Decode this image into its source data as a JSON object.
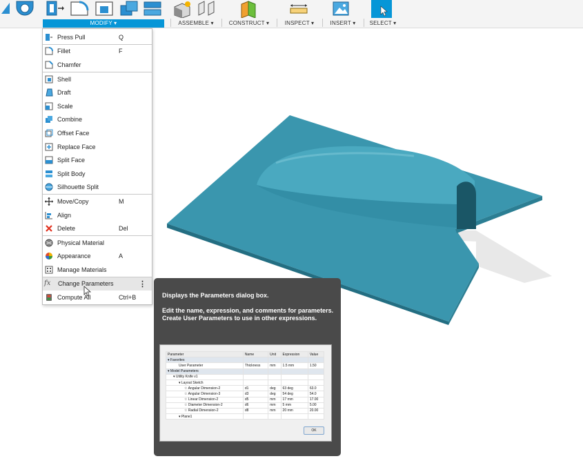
{
  "toolbar": {
    "groups": [
      {
        "label": "MODIFY ▾",
        "active": true
      },
      {
        "label": "ASSEMBLE ▾"
      },
      {
        "label": "CONSTRUCT ▾"
      },
      {
        "label": "INSPECT ▾"
      },
      {
        "label": "INSERT ▾"
      },
      {
        "label": "SELECT ▾"
      }
    ]
  },
  "menu": {
    "items": [
      {
        "label": "Press Pull",
        "shortcut": "Q",
        "icon": "press-pull-icon"
      },
      {
        "label": "Fillet",
        "shortcut": "F",
        "icon": "fillet-icon"
      },
      {
        "label": "Chamfer",
        "shortcut": "",
        "icon": "chamfer-icon"
      },
      {
        "label": "Shell",
        "shortcut": "",
        "icon": "shell-icon"
      },
      {
        "label": "Draft",
        "shortcut": "",
        "icon": "draft-icon"
      },
      {
        "label": "Scale",
        "shortcut": "",
        "icon": "scale-icon"
      },
      {
        "label": "Combine",
        "shortcut": "",
        "icon": "combine-icon"
      },
      {
        "label": "Offset Face",
        "shortcut": "",
        "icon": "offset-face-icon"
      },
      {
        "label": "Replace Face",
        "shortcut": "",
        "icon": "replace-face-icon"
      },
      {
        "label": "Split Face",
        "shortcut": "",
        "icon": "split-face-icon"
      },
      {
        "label": "Split Body",
        "shortcut": "",
        "icon": "split-body-icon"
      },
      {
        "label": "Silhouette Split",
        "shortcut": "",
        "icon": "silhouette-split-icon"
      },
      {
        "label": "Move/Copy",
        "shortcut": "M",
        "icon": "move-copy-icon"
      },
      {
        "label": "Align",
        "shortcut": "",
        "icon": "align-icon"
      },
      {
        "label": "Delete",
        "shortcut": "Del",
        "icon": "delete-icon"
      },
      {
        "label": "Physical Material",
        "shortcut": "",
        "icon": "physical-material-icon"
      },
      {
        "label": "Appearance",
        "shortcut": "A",
        "icon": "appearance-icon"
      },
      {
        "label": "Manage Materials",
        "shortcut": "",
        "icon": "manage-materials-icon"
      },
      {
        "label": "Change Parameters",
        "shortcut": "",
        "icon": "fx-icon"
      },
      {
        "label": "Compute All",
        "shortcut": "Ctrl+B",
        "icon": "compute-all-icon"
      }
    ]
  },
  "tooltip": {
    "title": "Displays the Parameters dialog box.",
    "body": "Edit the name, expression, and comments for parameters. Create User Parameters to use in other expressions.",
    "table": {
      "headers": [
        "Parameter",
        "Name",
        "Unit",
        "Expression",
        "Value"
      ],
      "rows": [
        {
          "indent": 0,
          "cells": [
            "▾  Favorites",
            "",
            "",
            "",
            ""
          ],
          "group": true
        },
        {
          "indent": 2,
          "cells": [
            "User Parameter",
            "Thickness",
            "mm",
            "1.5 mm",
            "1.50"
          ]
        },
        {
          "indent": 0,
          "cells": [
            "▾  Model Parameters",
            "",
            "",
            "",
            ""
          ],
          "group": true
        },
        {
          "indent": 1,
          "cells": [
            "▾  Utility Knife v1",
            "",
            "",
            "",
            ""
          ]
        },
        {
          "indent": 2,
          "cells": [
            "▾  Layout Sketch",
            "",
            "",
            "",
            ""
          ]
        },
        {
          "indent": 3,
          "cells": [
            "☆  Angular Dimension-2",
            "d1",
            "deg",
            "63 deg",
            "63.0"
          ]
        },
        {
          "indent": 3,
          "cells": [
            "☆  Angular Dimension-3",
            "d3",
            "deg",
            "54 deg",
            "54.0"
          ]
        },
        {
          "indent": 3,
          "cells": [
            "☆  Linear Dimension-2",
            "d5",
            "mm",
            "17 mm",
            "17.00"
          ]
        },
        {
          "indent": 3,
          "cells": [
            "☆  Diameter Dimension-2",
            "d6",
            "mm",
            "5 mm",
            "5.00"
          ]
        },
        {
          "indent": 3,
          "cells": [
            "☆  Radial Dimension-2",
            "d8",
            "mm",
            "20 mm",
            "20.00"
          ]
        },
        {
          "indent": 2,
          "cells": [
            "▾  Plane1",
            "",
            "",
            "",
            ""
          ]
        }
      ]
    },
    "ok_label": "OK"
  }
}
